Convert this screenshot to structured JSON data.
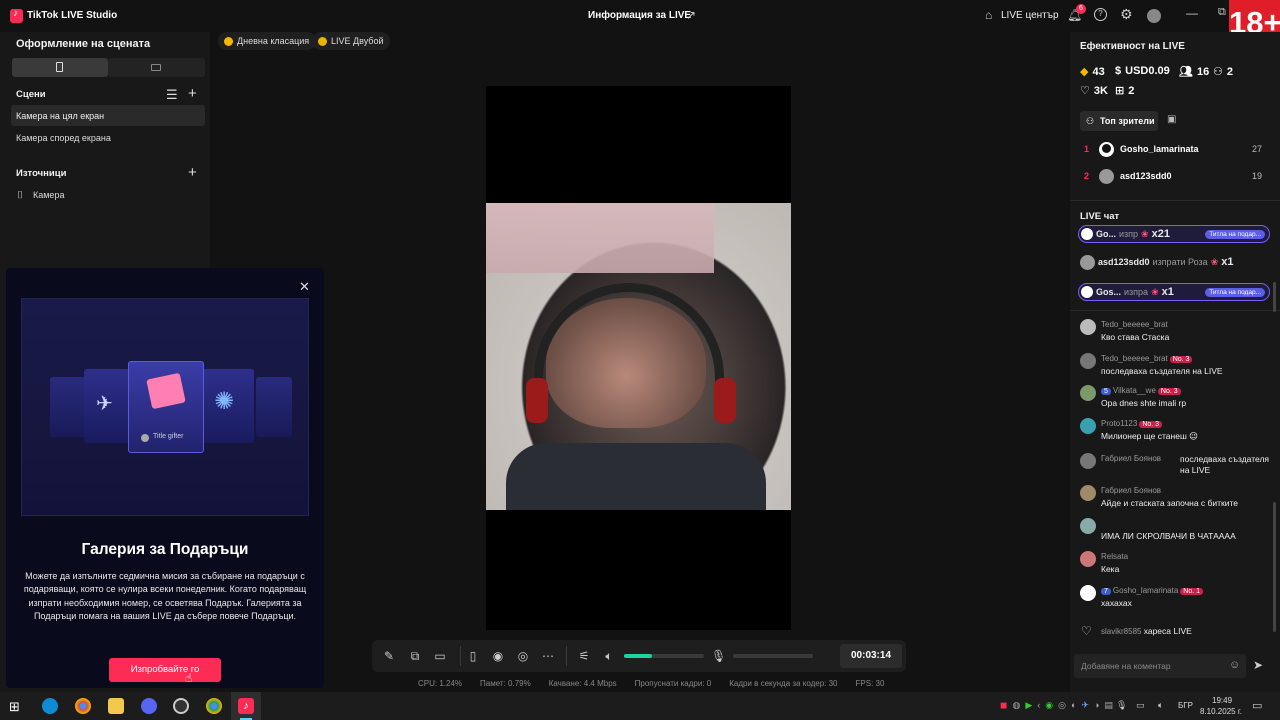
{
  "titlebar": {
    "app_title": "TikTok LIVE Studio",
    "center_title": "Информация за LIVE",
    "live_center": "LIVE център",
    "notif_count": "6",
    "age_badge": "18+"
  },
  "left": {
    "scene_layout": "Оформление на сцената",
    "scenes_title": "Сцени",
    "scenes": [
      "Камера на цял екран",
      "Камера според екрана"
    ],
    "sources_title": "Източници",
    "sources": [
      "Камера"
    ]
  },
  "popup": {
    "badge": "Title gifter",
    "title": "Галерия за Подаръци",
    "body": "Можете да изпълните седмична мисия за събиране на подаръци с подаряващи, която се нулира всеки понеделник. Когато подаряващ изпрати необходимия номер, се осветява Подарък. Галерията за Подаръци помага на вашия LIVE да събере повече Подаръци.",
    "button": "Изпробвайте го"
  },
  "center": {
    "chips": [
      "Дневна класация",
      "LIVE Двубой"
    ],
    "timer": "00:03:14",
    "volume_level": 0.35,
    "stats": [
      "CPU: 1.24%",
      "Памет: 0.79%",
      "Качване: 4.4 Mbps",
      "Пропуснати кадри: 0",
      "Кадри в секунда за кодер: 30",
      "FPS: 30"
    ]
  },
  "right": {
    "perf_title": "Ефективност на LIVE",
    "diamonds": "43",
    "usd": "USD0.09",
    "viewers": "16",
    "new": "2",
    "likes": "3K",
    "gifts": "2",
    "top_viewers_tab": "Топ зрители",
    "top_viewers": [
      {
        "rank": "1",
        "name": "Gosho_lamarinata",
        "score": "27"
      },
      {
        "rank": "2",
        "name": "asd123sdd0",
        "score": "19"
      }
    ],
    "chat_title": "LIVE чат",
    "gift_rows": [
      {
        "name": "Go...",
        "verb": "изпр",
        "count": "x21",
        "tag": "Титла на подар..."
      },
      {
        "name": "asd123sdd0",
        "verb": "изпрати Роза",
        "count": "x1",
        "tag": ""
      },
      {
        "name": "Gos...",
        "verb": "изпра",
        "count": "x1",
        "tag": "Титла на подар..."
      }
    ],
    "messages": [
      {
        "user": "Tedo_beeeee_brat",
        "lvl": "",
        "no": "",
        "text": "Кво става Стаска"
      },
      {
        "user": "Tedo_beeeee_brat",
        "lvl": "",
        "no": "No. 3",
        "text": "последваха създателя на LIVE"
      },
      {
        "user": "Vilkata__we",
        "lvl": "5",
        "no": "No. 3",
        "text": "Opa dnes shte imali rp"
      },
      {
        "user": "Proto1123",
        "lvl": "",
        "no": "No. 3",
        "text": "Милионер ще станеш 😉"
      },
      {
        "user": "Габриел Боянов",
        "lvl": "",
        "no": "",
        "text": "последваха създателя на LIVE"
      },
      {
        "user": "Габриел Боянов",
        "lvl": "",
        "no": "",
        "text": "Айде и стаската започна с битките"
      },
      {
        "user": "",
        "lvl": "",
        "no": "",
        "text": "ИМА ЛИ СКРОЛВАЧИ В ЧАТАААА"
      },
      {
        "user": "Relsata",
        "lvl": "",
        "no": "",
        "text": "Кека"
      },
      {
        "user": "Gosho_lamarinata",
        "lvl": "7",
        "no": "No. 1",
        "text": "хахахах"
      },
      {
        "user": "slavikr8585",
        "lvl": "",
        "no": "",
        "text": "хареса LIVE"
      }
    ],
    "comment_placeholder": "Добавяне на коментар"
  },
  "taskbar": {
    "lang": "БГР",
    "time": "19:49",
    "date": "8.10.2025 г."
  },
  "colors": {
    "accent": "#fe2c55",
    "volume": "#18d6a4"
  }
}
